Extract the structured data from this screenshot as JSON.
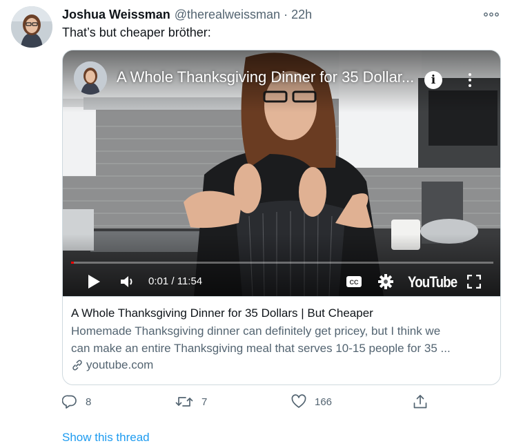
{
  "tweet": {
    "display_name": "Joshua Weissman",
    "handle": "@therealweissman",
    "separator": "·",
    "time": "22h",
    "text": "That’s but cheaper bröther:",
    "more_icon": "more-horizontal-icon"
  },
  "card": {
    "video": {
      "title": "A Whole Thanksgiving Dinner for 35 Dollar...",
      "current_time": "0:01",
      "duration": "11:54",
      "time_separator": " / ",
      "progress_fraction": 0.0014,
      "brand": "YouTube",
      "icons": [
        "info-icon",
        "kebab-menu-icon",
        "play-icon",
        "volume-icon",
        "captions-icon",
        "settings-icon",
        "fullscreen-icon"
      ]
    },
    "title": "A Whole Thanksgiving Dinner for 35 Dollars | But Cheaper",
    "description_line1": "Homemade Thanksgiving dinner can definitely get pricey, but I think we",
    "description_line2": "can make an entire Thanksgiving meal that serves 10-15 people for 35 ...",
    "domain": "youtube.com"
  },
  "actions": {
    "reply_count": "8",
    "retweet_count": "7",
    "like_count": "166"
  },
  "show_thread": "Show this thread",
  "colors": {
    "accent": "#1d9bf0",
    "secondary_text": "#536471",
    "border": "#cfd9de"
  }
}
